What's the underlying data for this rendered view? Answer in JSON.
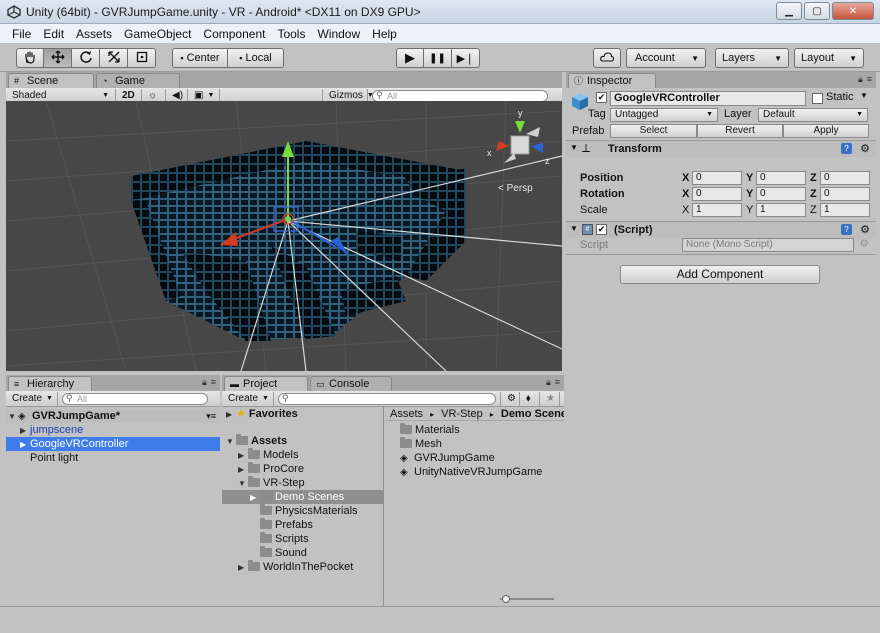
{
  "window": {
    "title": "Unity (64bit) - GVRJumpGame.unity - VR - Android* <DX11 on DX9 GPU>",
    "minimize_glyph": "▁",
    "maximize_glyph": "▢",
    "close_glyph": "✕"
  },
  "menubar": {
    "items": [
      "File",
      "Edit",
      "Assets",
      "GameObject",
      "Component",
      "Tools",
      "Window",
      "Help"
    ]
  },
  "toolbar": {
    "tools": [
      "hand-icon",
      "move-icon",
      "rotate-icon",
      "scale-icon",
      "rect-icon"
    ],
    "pivot_label": "Center",
    "space_label": "Local",
    "play_glyph": "▶",
    "pause_glyph": "❚❚",
    "step_glyph": "▶❘",
    "cloud_icon": "cloud-icon",
    "account_label": "Account",
    "layers_label": "Layers",
    "layout_label": "Layout"
  },
  "scene_panel": {
    "tabs": [
      "Scene",
      "Game"
    ],
    "shading_mode": "Shaded",
    "mode_2d_label": "2D",
    "gizmos_label": "Gizmos",
    "search_placeholder": "All",
    "persp_label": "Persp",
    "axis_x_label": "x",
    "axis_z_label": "z",
    "axis_y_label": "y"
  },
  "hierarchy": {
    "tab": "Hierarchy",
    "create_label": "Create",
    "search_placeholder": "All",
    "scene_name": "GVRJumpGame*",
    "items": [
      {
        "label": "jumpscene",
        "indent": 1,
        "expandable": true,
        "selected": false,
        "prefab": true
      },
      {
        "label": "GoogleVRController",
        "indent": 1,
        "expandable": true,
        "selected": true,
        "prefab": true
      },
      {
        "label": "Point light",
        "indent": 1,
        "expandable": false,
        "selected": false,
        "prefab": false
      }
    ]
  },
  "project": {
    "tabs": [
      "Project",
      "Console"
    ],
    "create_label": "Create",
    "favorites_label": "Favorites",
    "assets_label": "Assets",
    "tree": [
      {
        "label": "Models",
        "level": 1,
        "expandable": true,
        "selected": false
      },
      {
        "label": "ProCore",
        "level": 1,
        "expandable": true,
        "selected": false
      },
      {
        "label": "VR-Step",
        "level": 1,
        "expandable": true,
        "expanded": true,
        "selected": false
      },
      {
        "label": "Demo Scenes",
        "level": 2,
        "expandable": true,
        "selected": true
      },
      {
        "label": "PhysicsMaterials",
        "level": 2,
        "expandable": false,
        "selected": false
      },
      {
        "label": "Prefabs",
        "level": 2,
        "expandable": false,
        "selected": false
      },
      {
        "label": "Scripts",
        "level": 2,
        "expandable": false,
        "selected": false
      },
      {
        "label": "Sound",
        "level": 2,
        "expandable": false,
        "selected": false
      },
      {
        "label": "WorldInThePocket",
        "level": 1,
        "expandable": true,
        "selected": false
      }
    ],
    "breadcrumb": [
      "Assets",
      "VR-Step",
      "Demo Scenes"
    ],
    "breadcrumb_sep": "▸",
    "contents": [
      {
        "label": "Materials",
        "kind": "folder"
      },
      {
        "label": "Mesh",
        "kind": "folder"
      },
      {
        "label": "GVRJumpGame",
        "kind": "scene"
      },
      {
        "label": "UnityNativeVRJumpGame",
        "kind": "scene"
      }
    ],
    "zoom_level": 0.05
  },
  "inspector": {
    "tab": "Inspector",
    "object_name": "GoogleVRController",
    "active_checked": true,
    "static_label": "Static",
    "tag_label": "Tag",
    "tag_value": "Untagged",
    "layer_label": "Layer",
    "layer_value": "Default",
    "prefab_label": "Prefab",
    "prefab_buttons": [
      "Select",
      "Revert",
      "Apply"
    ],
    "transform": {
      "title": "Transform",
      "rows": [
        {
          "label": "Position",
          "x": "0",
          "y": "0",
          "z": "0"
        },
        {
          "label": "Rotation",
          "x": "0",
          "y": "0",
          "z": "0"
        },
        {
          "label": "Scale",
          "x": "1",
          "y": "1",
          "z": "1"
        }
      ],
      "axis_labels": [
        "X",
        "Y",
        "Z"
      ]
    },
    "script_component": {
      "title": "(Script)",
      "field_label": "Script",
      "field_value": "None (Mono Script)"
    },
    "add_component_label": "Add Component"
  }
}
